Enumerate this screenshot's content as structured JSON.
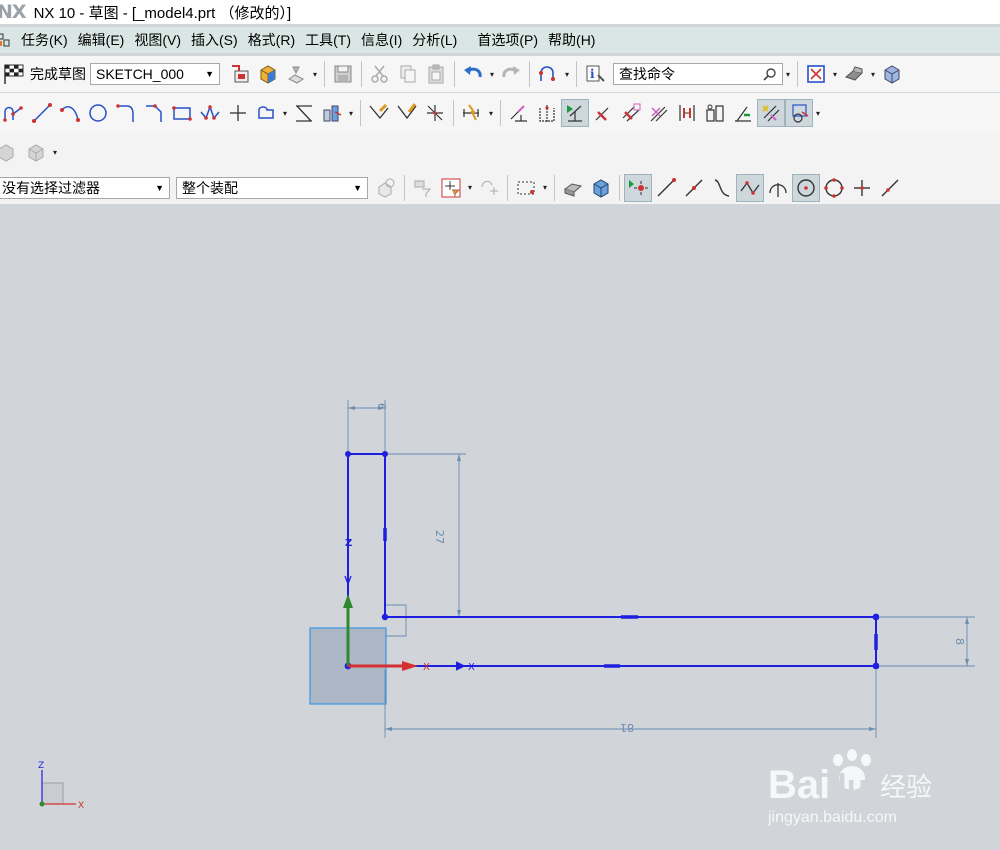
{
  "titlebar": {
    "logo": "NX",
    "title": "NX 10 - 草图 - [_model4.prt （修改的）]"
  },
  "menu": [
    "任务(K)",
    "编辑(E)",
    "视图(V)",
    "插入(S)",
    "格式(R)",
    "工具(T)",
    "信息(I)",
    "分析(L)",
    "首选项(P)",
    "帮助(H)"
  ],
  "toolbar1": {
    "finish_label": "完成草图",
    "sketch_name": "SKETCH_000",
    "search_placeholder": "查找命令"
  },
  "selection_bar": {
    "filter": "没有选择过滤器",
    "scope": "整个装配"
  },
  "sketch": {
    "dimensions": {
      "top_width": "6",
      "vertical_height": "27",
      "right_height": "8",
      "bottom_length": "81"
    },
    "axis_labels": {
      "z": "Z",
      "x": "X"
    },
    "triad_labels": {
      "z": "Z",
      "x": "X"
    },
    "colors": {
      "sketch_line": "#1f1fe0",
      "dimension": "#6a8db3",
      "x_axis": "#d43030",
      "z_axis": "#2e8a2e",
      "datum_plane": "#a6b3c2"
    }
  },
  "watermark": {
    "brand": "Bai",
    "brand2": "du",
    "cn": "经验",
    "url": "jingyan.baidu.com"
  }
}
